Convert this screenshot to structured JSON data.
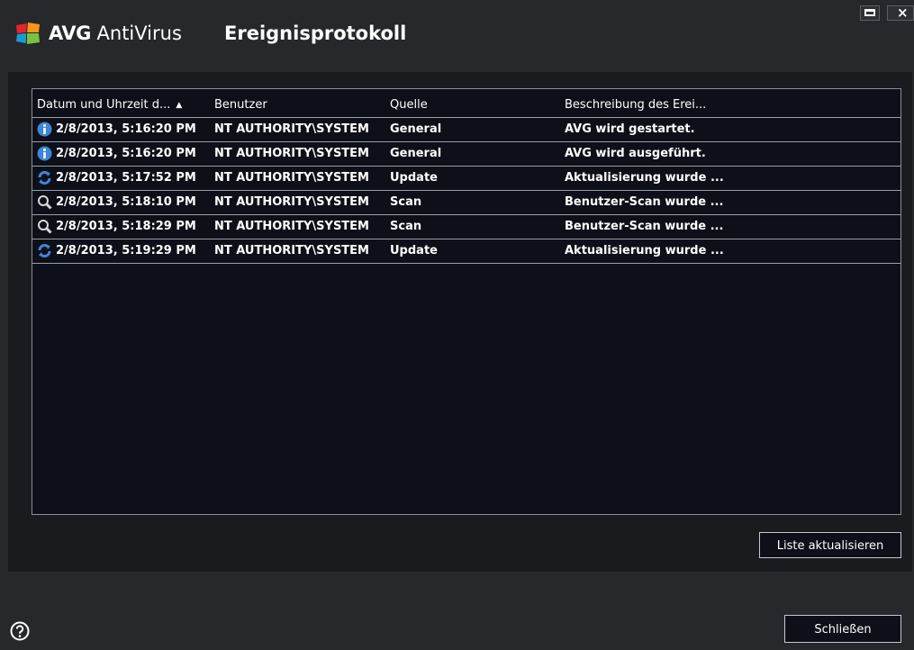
{
  "app": {
    "brand": "AVG",
    "product": "AntiVirus",
    "window_title": "Ereignisprotokoll",
    "logo_colors": [
      "#e2262b",
      "#f7941e",
      "#1c9ad6",
      "#79c143"
    ]
  },
  "table": {
    "columns": [
      {
        "label": "Datum und Uhrzeit d...",
        "sort": "ascending"
      },
      {
        "label": "Benutzer"
      },
      {
        "label": "Quelle"
      },
      {
        "label": "Beschreibung des Erei..."
      }
    ],
    "rows": [
      {
        "icon": "info-icon",
        "datetime": "2/8/2013, 5:16:20 PM",
        "user": "NT AUTHORITY\\SYSTEM",
        "source": "General",
        "description": "AVG wird gestartet."
      },
      {
        "icon": "info-icon",
        "datetime": "2/8/2013, 5:16:20 PM",
        "user": "NT AUTHORITY\\SYSTEM",
        "source": "General",
        "description": "AVG wird ausgeführt."
      },
      {
        "icon": "update-icon",
        "datetime": "2/8/2013, 5:17:52 PM",
        "user": "NT AUTHORITY\\SYSTEM",
        "source": "Update",
        "description": "Aktualisierung wurde ..."
      },
      {
        "icon": "scan-icon",
        "datetime": "2/8/2013, 5:18:10 PM",
        "user": "NT AUTHORITY\\SYSTEM",
        "source": "Scan",
        "description": "Benutzer-Scan wurde ..."
      },
      {
        "icon": "scan-icon",
        "datetime": "2/8/2013, 5:18:29 PM",
        "user": "NT AUTHORITY\\SYSTEM",
        "source": "Scan",
        "description": "Benutzer-Scan wurde ..."
      },
      {
        "icon": "update-icon",
        "datetime": "2/8/2013, 5:19:29 PM",
        "user": "NT AUTHORITY\\SYSTEM",
        "source": "Update",
        "description": "Aktualisierung wurde ..."
      }
    ]
  },
  "buttons": {
    "refresh_label": "Liste aktualisieren",
    "close_label": "Schließen"
  },
  "colors": {
    "background": "#26282c",
    "grid_background": "#0e1019",
    "info_icon": "#3f86d9",
    "update_icon": "#3f86d9"
  }
}
